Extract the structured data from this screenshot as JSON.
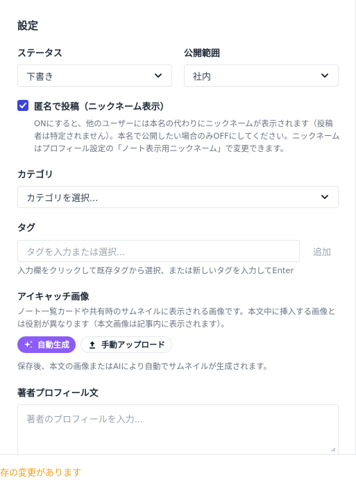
{
  "panel": {
    "title": "設定"
  },
  "status": {
    "label": "ステータス",
    "value": "下書き"
  },
  "visibility": {
    "label": "公開範囲",
    "value": "社内"
  },
  "anonymous": {
    "checked": true,
    "label": "匿名で投稿（ニックネーム表示）",
    "help_lines": [
      "ONにすると、他のユーザーには本名の代わりにニックネームが表示されます（投稿",
      "者は特定されません）。本名で公開したい場合のみOFFにしてください。ニックネーム",
      "はプロフィール設定の「ノート表示用ニックネーム」で変更できます。"
    ]
  },
  "category": {
    "label": "カテゴリ",
    "value": "カテゴリを選択..."
  },
  "tags": {
    "label": "タグ",
    "placeholder": "タグを入力または選択...",
    "add_label": "追加",
    "help": "入力欄をクリックして既存タグから選択、または新しいタグを入力してEnter"
  },
  "thumbnail": {
    "label": "アイキャッチ画像",
    "help_lines": [
      "ノート一覧カードや共有時のサムネイルに表示される画像です。本文中に挿入する画像と",
      "は役割が異なります（本文画像は記事内に表示されます）。"
    ],
    "auto_label": "自動生成",
    "manual_label": "手動アップロード",
    "note": "保存後、本文の画像またはAIにより自動でサムネイルが生成されます。"
  },
  "profile": {
    "label": "著者プロフィール文",
    "placeholder": "著者のプロフィールを入力..."
  },
  "footer": {
    "unsaved_text": "存の変更があります"
  },
  "colors": {
    "accent": "#3b44d6",
    "auto_pill": "#8b5cf6",
    "warning": "#f59e0b"
  }
}
